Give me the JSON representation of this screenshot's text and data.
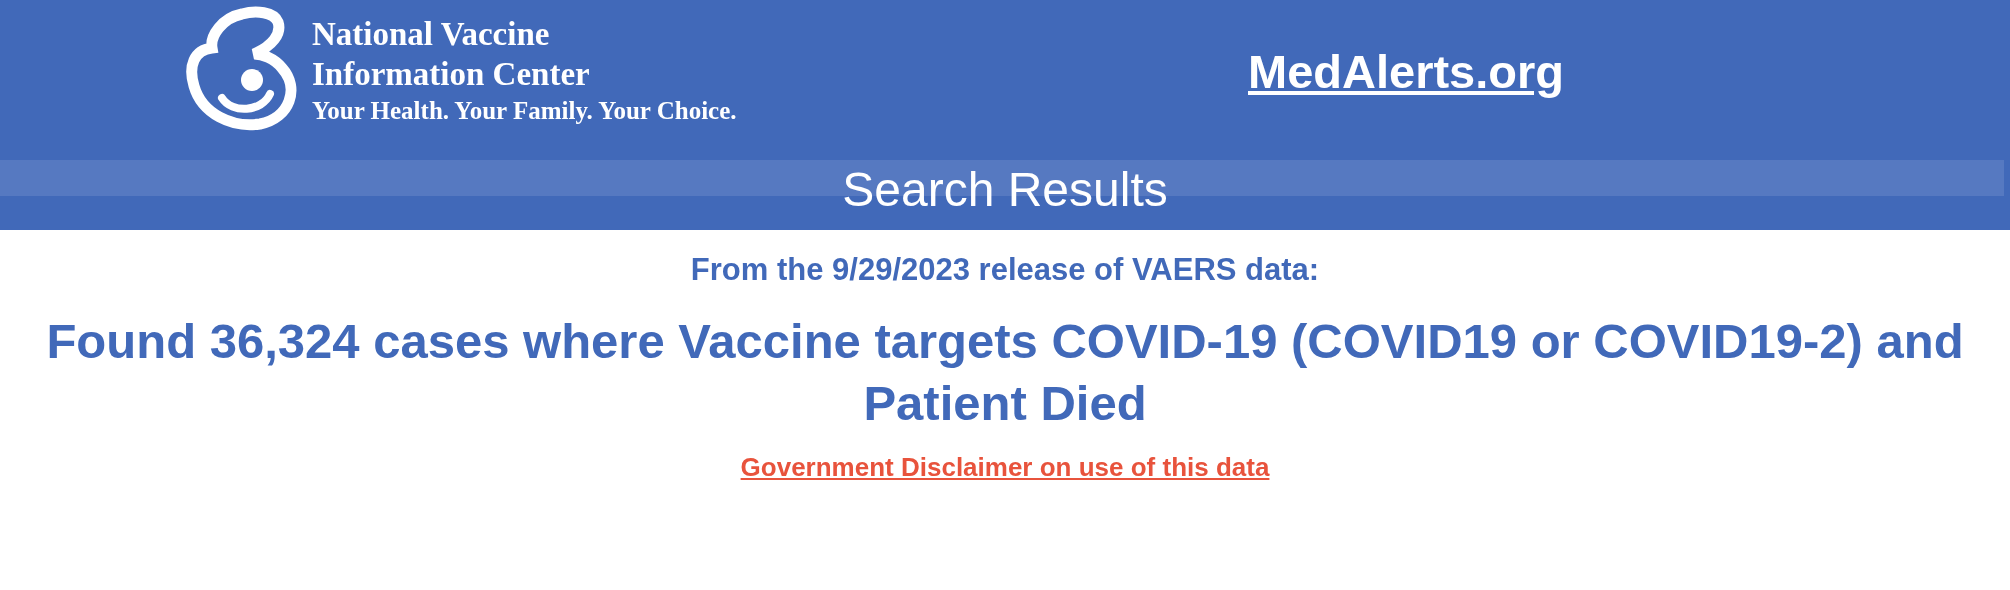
{
  "header": {
    "org_name_lines": [
      "National Vaccine",
      "Information Center"
    ],
    "tagline": "Your Health. Your Family. Your Choice.",
    "site_link": "MedAlerts.org"
  },
  "title_bar": {
    "title": "Search Results"
  },
  "results": {
    "release_note": "From the 9/29/2023 release of VAERS data:",
    "summary": "Found 36,324 cases where Vaccine targets COVID-19 (COVID19 or COVID19-2) and Patient Died",
    "disclaimer_link": "Government Disclaimer on use of this data"
  }
}
